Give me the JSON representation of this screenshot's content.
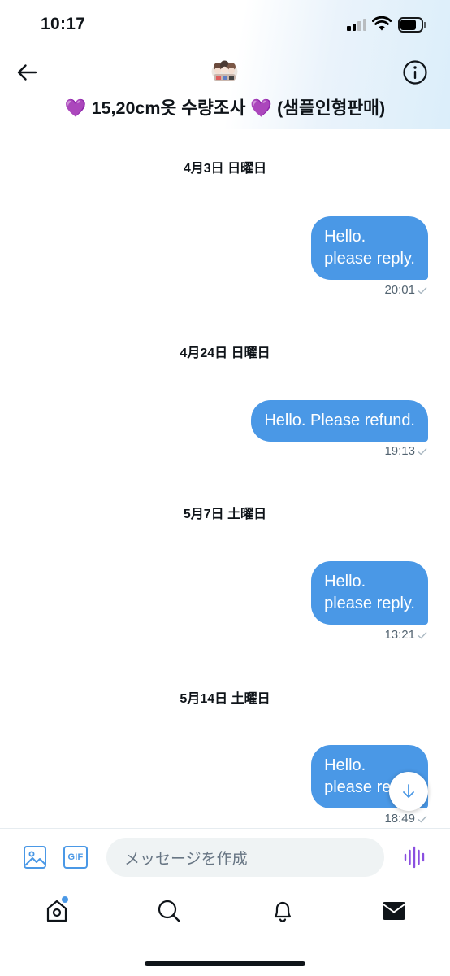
{
  "status_bar": {
    "time": "10:17"
  },
  "header": {
    "title_prefix": "💜",
    "title_main": " 15,20cm옷 수량조사 ",
    "title_heart2": "💜",
    "title_suffix": " (샘플인형판매)"
  },
  "messages": [
    {
      "date": "4月3日 日曜日",
      "text": "Hello.\nplease reply.",
      "time": "20:01"
    },
    {
      "date": "4月24日 日曜日",
      "text": "Hello.  Please refund.",
      "time": "19:13"
    },
    {
      "date": "5月7日 土曜日",
      "text": "Hello.\nplease reply.",
      "time": "13:21"
    },
    {
      "date": "5月14日 土曜日",
      "text": "Hello.\nplease reply.",
      "time": "18:49"
    }
  ],
  "composer": {
    "placeholder": "メッセージを作成",
    "gif_label": "GIF"
  },
  "colors": {
    "accent": "#4a98e6",
    "bubble": "#4a98e6",
    "voice": "#8a4fe0",
    "heart": "#8a3ad9"
  },
  "icons": {
    "back": "arrow-left-icon",
    "info": "info-icon",
    "image": "image-icon",
    "gif": "gif-icon",
    "voice": "voice-waveform-icon",
    "scroll": "arrow-down-icon",
    "tabs": [
      "home-icon",
      "search-icon",
      "bell-icon",
      "mail-icon"
    ]
  }
}
